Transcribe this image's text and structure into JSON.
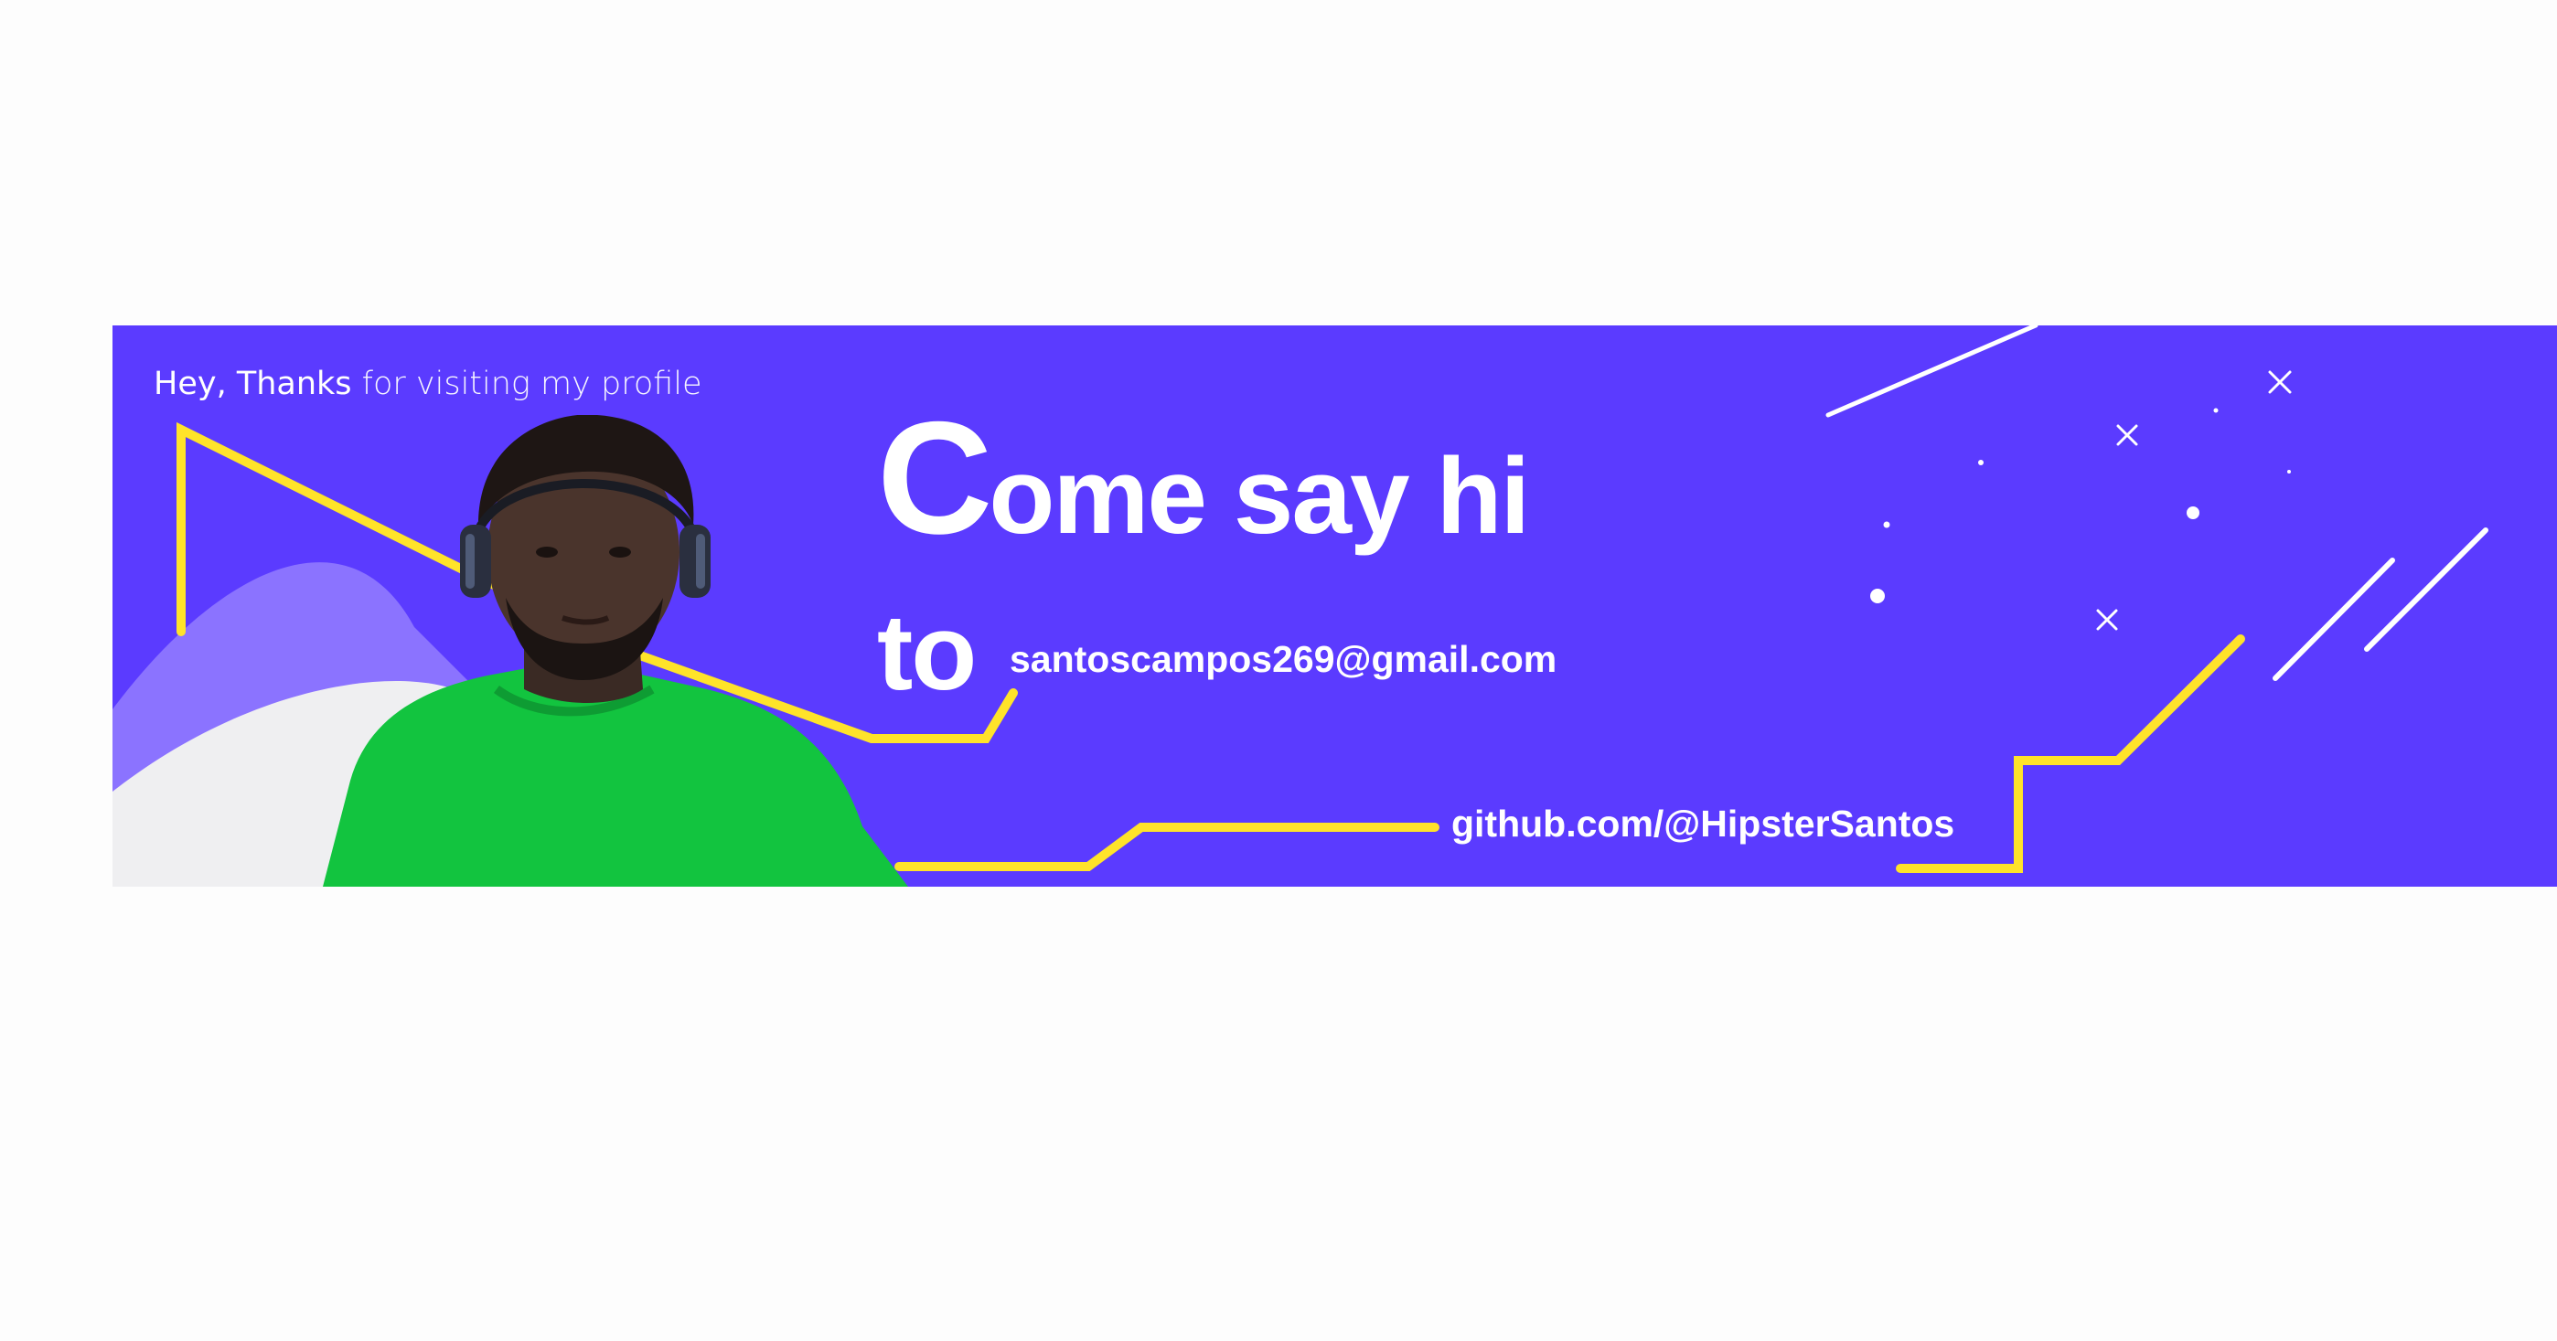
{
  "banner": {
    "greeting_strong": "Hey, Thanks",
    "greeting_light": " for visiting my profile",
    "headline_cap": "C",
    "headline_rest": "ome say hi",
    "to_word": "to",
    "email": "santoscampos269@gmail.com",
    "github": "github.com/@HipsterSantos"
  },
  "colors": {
    "background": "#5b3bff",
    "accent_yellow": "#ffe32a",
    "wave_light": "#8b73ff",
    "wave_gray": "#f0f0f0",
    "shirt_green": "#12c43f"
  },
  "icons": {
    "portrait": "person-with-headphones-photo",
    "decorations": [
      "diagonal-line",
      "sparkle-x",
      "dot"
    ]
  }
}
